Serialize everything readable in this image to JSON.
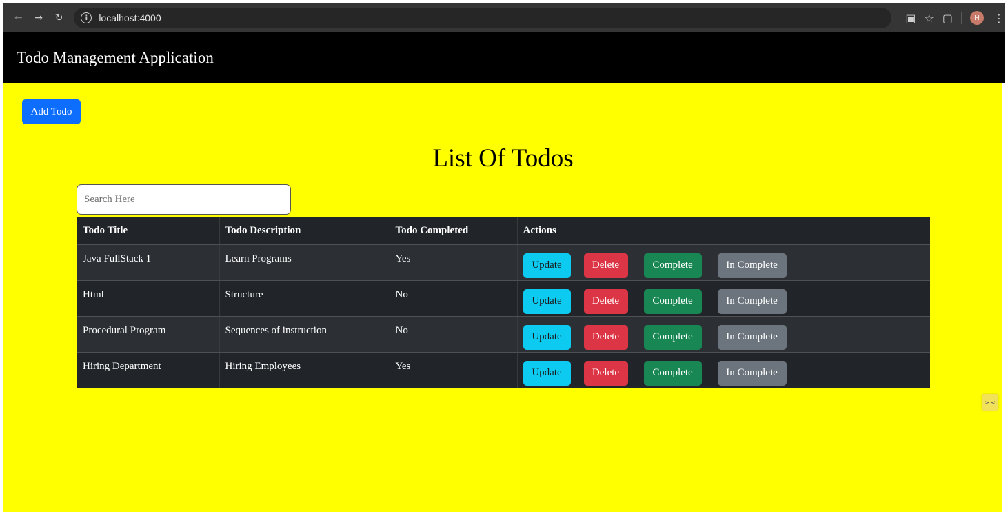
{
  "browser": {
    "url": "localhost:4000",
    "icons": [
      "back-icon",
      "forward-icon",
      "reload-icon",
      "info-icon",
      "translate-icon",
      "star-icon",
      "extensions-icon",
      "profile-avatar",
      "menu-icon"
    ],
    "profile_initial": "H"
  },
  "header": {
    "title": "Todo Management Application"
  },
  "toolbar": {
    "add_label": "Add Todo"
  },
  "main": {
    "title": "List Of Todos",
    "search_placeholder": "Search Here"
  },
  "table": {
    "columns": [
      "Todo Title",
      "Todo Description",
      "Todo Completed",
      "Actions"
    ],
    "rows": [
      {
        "title": "Java FullStack 1",
        "description": "Learn Programs",
        "completed": "Yes"
      },
      {
        "title": "Html",
        "description": "Structure",
        "completed": "No"
      },
      {
        "title": "Procedural Program",
        "description": "Sequences of instruction",
        "completed": "No"
      },
      {
        "title": "Hiring Department",
        "description": "Hiring Employees",
        "completed": "Yes"
      }
    ],
    "action_labels": {
      "update": "Update",
      "delete": "Delete",
      "complete": "Complete",
      "incomplete": "In Complete"
    }
  },
  "colors": {
    "page_background": "#ffff00",
    "header_background": "#000000",
    "primary": "#0d6efd",
    "info": "#0dcaf0",
    "danger": "#dc3545",
    "success": "#198754",
    "secondary": "#6c757d",
    "table_dark": "#212529"
  }
}
